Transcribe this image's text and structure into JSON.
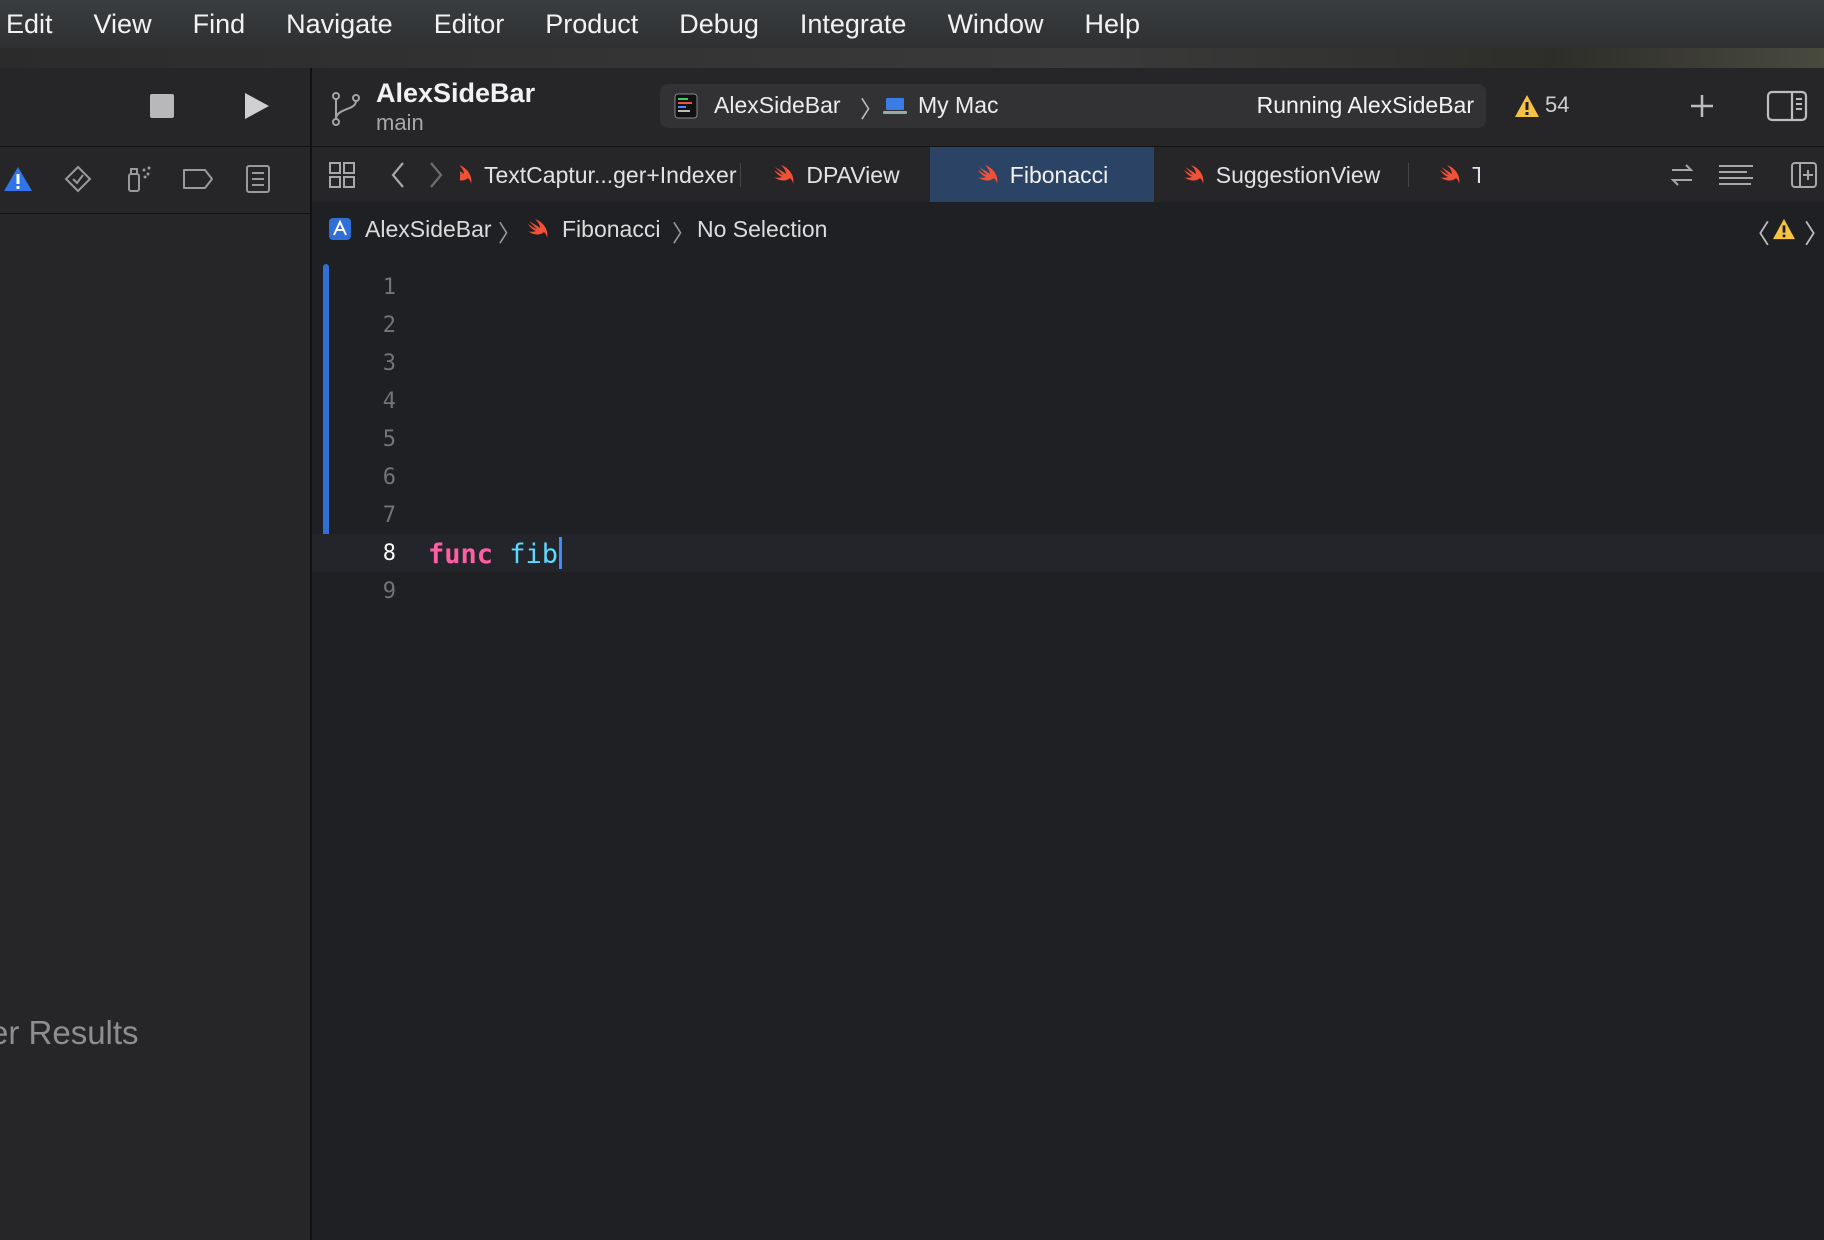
{
  "menubar": {
    "items": [
      "Edit",
      "View",
      "Find",
      "Navigate",
      "Editor",
      "Product",
      "Debug",
      "Integrate",
      "Window",
      "Help"
    ]
  },
  "navigator": {
    "icons": [
      "issue-navigator-icon",
      "test-navigator-icon",
      "debug-navigator-icon",
      "breakpoint-navigator-icon",
      "report-navigator-icon"
    ],
    "filter_results_text": "er Results"
  },
  "toolbar": {
    "project_name": "AlexSideBar",
    "branch": "main",
    "scheme_name": "AlexSideBar",
    "scheme_chevron": "〉",
    "destination": "My Mac",
    "run_status": "Running AlexSideBar",
    "warning_count": "54"
  },
  "tabs": [
    {
      "label": "TextCaptur...ger+Indexer",
      "active": false
    },
    {
      "label": "DPAView",
      "active": false
    },
    {
      "label": "Fibonacci",
      "active": true
    },
    {
      "label": "SuggestionView",
      "active": false
    },
    {
      "label": "TextC",
      "active": false
    }
  ],
  "jumpbar": {
    "project": "AlexSideBar",
    "separator": "〉",
    "file": "Fibonacci",
    "selection": "No Selection",
    "prev": "〈",
    "next": "〉"
  },
  "editor": {
    "line_numbers": [
      "1",
      "2",
      "3",
      "4",
      "5",
      "6",
      "7",
      "8",
      "9"
    ],
    "current_line": "8",
    "code_keyword": "func",
    "code_identifier": "fib"
  },
  "colors": {
    "accent_blue": "#2f6fd6",
    "active_tab": "#2b4466",
    "keyword_pink": "#fc5fa3",
    "identifier_cyan": "#5dd8ff",
    "warning_yellow": "#f5c242",
    "swift_orange": "#f05138"
  }
}
